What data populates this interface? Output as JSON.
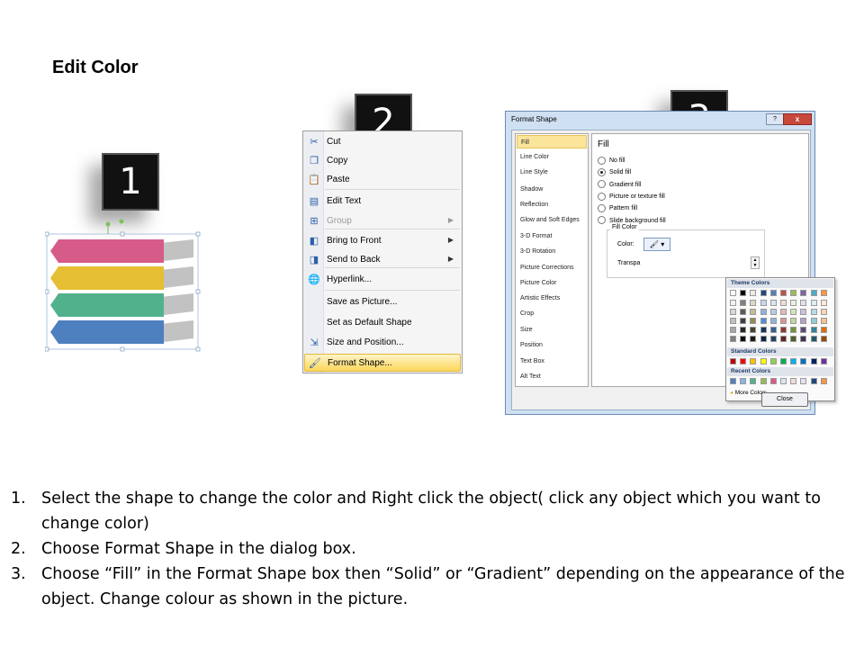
{
  "title": "Edit Color",
  "badges": [
    "1",
    "2",
    "3"
  ],
  "shape": {
    "colors": [
      "#d75b89",
      "#e6be34",
      "#52b18d",
      "#4e7fbf",
      "#c2c2c2"
    ]
  },
  "context_menu": {
    "items": [
      {
        "label": "Cut",
        "icon": "scissors-icon",
        "glyph": "✂",
        "disabled": false,
        "submenu": false,
        "highlight": false
      },
      {
        "label": "Copy",
        "icon": "copy-icon",
        "glyph": "❐",
        "disabled": false,
        "submenu": false,
        "highlight": false
      },
      {
        "label": "Paste",
        "icon": "paste-icon",
        "glyph": "📋",
        "disabled": false,
        "submenu": false,
        "highlight": false
      },
      {
        "label": "Edit Text",
        "icon": "edit-text-icon",
        "glyph": "▤",
        "disabled": false,
        "submenu": false,
        "highlight": false
      },
      {
        "label": "Group",
        "icon": "group-icon",
        "glyph": "⊞",
        "disabled": true,
        "submenu": true,
        "highlight": false
      },
      {
        "label": "Bring to Front",
        "icon": "bring-to-front-icon",
        "glyph": "◧",
        "disabled": false,
        "submenu": true,
        "highlight": false
      },
      {
        "label": "Send to Back",
        "icon": "send-to-back-icon",
        "glyph": "◨",
        "disabled": false,
        "submenu": true,
        "highlight": false
      },
      {
        "label": "Hyperlink...",
        "icon": "hyperlink-icon",
        "glyph": "🌐",
        "disabled": false,
        "submenu": false,
        "highlight": false
      },
      {
        "label": "Save as Picture...",
        "icon": "",
        "glyph": "",
        "disabled": false,
        "submenu": false,
        "highlight": false
      },
      {
        "label": "Set as Default Shape",
        "icon": "",
        "glyph": "",
        "disabled": false,
        "submenu": false,
        "highlight": false
      },
      {
        "label": "Size and Position...",
        "icon": "size-position-icon",
        "glyph": "⇲",
        "disabled": false,
        "submenu": false,
        "highlight": false
      },
      {
        "label": "Format Shape...",
        "icon": "format-shape-icon",
        "glyph": "🖌",
        "disabled": false,
        "submenu": false,
        "highlight": true
      }
    ]
  },
  "dialog": {
    "title": "Format Shape",
    "help": "?",
    "close_x": "x",
    "nav": [
      "Fill",
      "Line Color",
      "Line Style",
      "Shadow",
      "Reflection",
      "Glow and Soft Edges",
      "3-D Format",
      "3-D Rotation",
      "Picture Corrections",
      "Picture Color",
      "Artistic Effects",
      "Crop",
      "Size",
      "Position",
      "Text Box",
      "Alt Text"
    ],
    "selected_nav": "Fill",
    "fill_heading": "Fill",
    "options": [
      {
        "label": "No fill",
        "checked": false
      },
      {
        "label": "Solid fill",
        "checked": true
      },
      {
        "label": "Gradient fill",
        "checked": false
      },
      {
        "label": "Picture or texture fill",
        "checked": false
      },
      {
        "label": "Pattern fill",
        "checked": false
      },
      {
        "label": "Slide background fill",
        "checked": false
      }
    ],
    "fill_color_group": "Fill Color",
    "color_label": "Color:",
    "transparency_label": "Transpa",
    "popup": {
      "theme_label": "Theme Colors",
      "standard_label": "Standard Colors",
      "recent_label": "Recent Colors",
      "more_colors": "More Colors...",
      "theme_top": [
        "#ffffff",
        "#000000",
        "#eeece1",
        "#1f497d",
        "#4f81bd",
        "#c0504d",
        "#9bbb59",
        "#8064a2",
        "#4bacc6",
        "#f79646"
      ],
      "theme_shades": [
        [
          "#f2f2f2",
          "#7f7f7f",
          "#ddd9c3",
          "#c6d9f0",
          "#dbe5f1",
          "#f2dcdb",
          "#ebf1dd",
          "#e5e0ec",
          "#dbeef3",
          "#fdeada"
        ],
        [
          "#d8d8d8",
          "#595959",
          "#c4bd97",
          "#8db3e2",
          "#b8cce4",
          "#e5b9b7",
          "#d7e3bc",
          "#ccc1d9",
          "#b7dde8",
          "#fbd5b5"
        ],
        [
          "#bfbfbf",
          "#3f3f3f",
          "#938953",
          "#548dd4",
          "#95b3d7",
          "#d99694",
          "#c3d69b",
          "#b2a2c7",
          "#92cddc",
          "#fac08f"
        ],
        [
          "#a5a5a5",
          "#262626",
          "#494429",
          "#17365d",
          "#366092",
          "#953734",
          "#76923c",
          "#5f497a",
          "#31859b",
          "#e36c09"
        ],
        [
          "#7f7f7f",
          "#0c0c0c",
          "#1d1b10",
          "#0f243e",
          "#244061",
          "#632423",
          "#4f6128",
          "#3f3151",
          "#205867",
          "#974806"
        ]
      ],
      "standard": [
        "#c00000",
        "#ff0000",
        "#ffc000",
        "#ffff00",
        "#92d050",
        "#00b050",
        "#00b0f0",
        "#0070c0",
        "#002060",
        "#7030a0"
      ],
      "recent": [
        "#4f81bd",
        "#8db3e2",
        "#52b18d",
        "#9bbb59",
        "#d75b89",
        "#dbe5f1",
        "#f2dcdb",
        "#e5e0ec",
        "#1f497d",
        "#f79646"
      ]
    },
    "close_button": "Close"
  },
  "steps": [
    {
      "num": "1.",
      "text": "Select the shape to change the color and Right click the object( click any object which you want to change color)"
    },
    {
      "num": "2.",
      "text": "Choose Format Shape in the dialog box."
    },
    {
      "num": "3.",
      "text": "Choose “Fill” in the Format Shape box then “Solid” or “Gradient” depending on the appearance of the object. Change colour as shown in the picture."
    }
  ]
}
